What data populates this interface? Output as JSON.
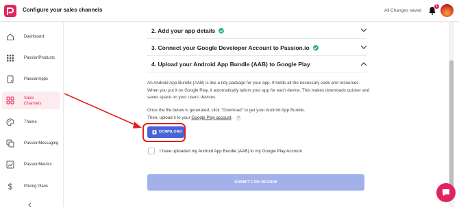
{
  "header": {
    "title": "Configure your sales channels",
    "saved_status": "All Changes saved",
    "notification_count": "1"
  },
  "sidebar": {
    "items": [
      {
        "label": "Dashboard",
        "icon": "home-icon"
      },
      {
        "label": "PassionProducts",
        "icon": "grid-icon"
      },
      {
        "label": "PassionApps",
        "icon": "phone-icon"
      },
      {
        "label": "Sales Channels",
        "icon": "channels-icon",
        "active": true
      },
      {
        "label": "Theme",
        "icon": "palette-icon"
      },
      {
        "label": "PassionMessaging",
        "icon": "message-icon"
      },
      {
        "label": "PassionMetrics",
        "icon": "chart-icon"
      },
      {
        "label": "Pricing Plans",
        "icon": "dollar-icon"
      }
    ]
  },
  "steps": [
    {
      "label": "2. Add your app details",
      "completed": true,
      "expanded": false
    },
    {
      "label": "3. Connect your Google Developer Account to Passion.io",
      "completed": true,
      "expanded": false
    },
    {
      "label": "4. Upload your Android App Bundle (AAB) to Google Play",
      "completed": false,
      "expanded": true
    }
  ],
  "step4": {
    "description": "An Android App Bundle (AAB) is like a tidy package for your app. It holds all the necessary code and resources. When you put it on Google Play, it automatically tailors your app for each device. This makes downloads quicker and saves space on your users' devices.",
    "instruction_line1": "Once the file below is generated, click \"Download\" to get your Android App Bundle.",
    "instruction_line2_prefix": "Then, upload it to your ",
    "instruction_link": "Google Play account",
    "instruction_suffix": ".",
    "help_label": "?",
    "download_label": "DOWNLOAD",
    "checkbox_label": "I have uploaded my Android App Bundle (AAB) to my Google Play Account",
    "submit_label": "SUBMIT FOR REVIEW"
  },
  "colors": {
    "brand": "#e0245e",
    "primary_button": "#4a63d8",
    "submit_disabled": "#a3b0ea",
    "check_green": "#2bb673",
    "annotation_red": "#e02020"
  }
}
